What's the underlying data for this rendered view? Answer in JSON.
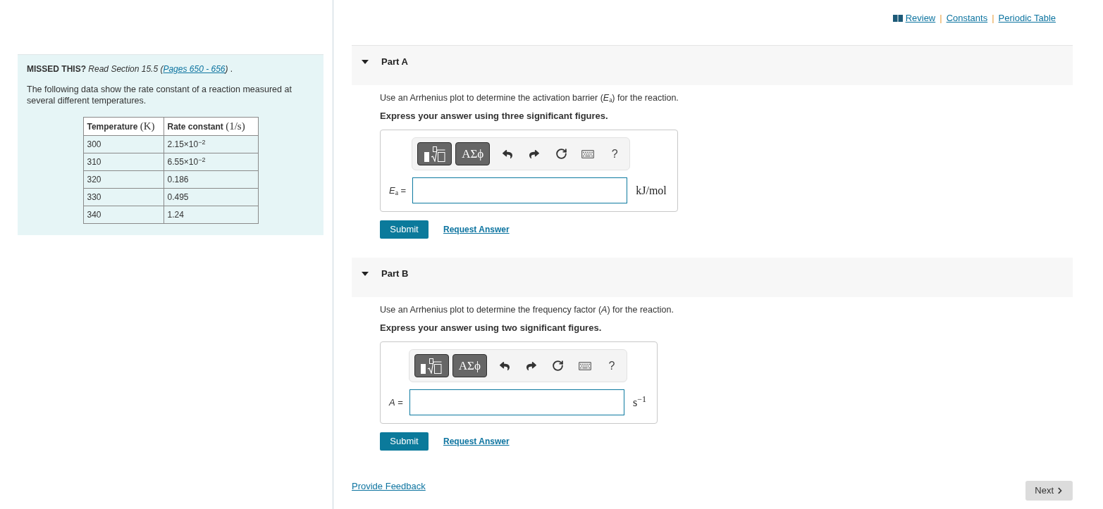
{
  "header": {
    "links": [
      {
        "label": "Review",
        "kind": "book"
      },
      {
        "label": "Constants",
        "kind": "plain",
        "separator": "|"
      },
      {
        "label": "Periodic Table",
        "kind": "plain",
        "separator": "|"
      }
    ]
  },
  "intro": {
    "missed_this": {
      "prefix": "**MISSED THIS?** *Read Section 15.5 (*",
      "link": "Pages 650 - 656",
      "suffix": "*)* ."
    },
    "description": "The following data show the rate constant of a reaction measured at several different temperatures.",
    "table": {
      "columns": [
        {
          "label": "Temperature",
          "unit": "(K)"
        },
        {
          "label": "Rate constant",
          "unit": "(1/s)"
        }
      ],
      "rows": [
        [
          "300",
          "2.15×10$^{−2}$"
        ],
        [
          "310",
          "6.55×10$^{−2}$"
        ],
        [
          "320",
          "0.186"
        ],
        [
          "330",
          "0.495"
        ],
        [
          "340",
          "1.24"
        ]
      ]
    }
  },
  "parts": [
    {
      "title": "Part A",
      "expanded": true,
      "question": "Use an Arrhenius plot to determine the activation barrier (*E*$_{a}$) for the reaction.",
      "instruction": "Express your answer using three significant figures.",
      "toolbar": {
        "symbols_label": "ΑΣϕ",
        "help_label": "?"
      },
      "variable": "*E*$_{a}$ =",
      "unit": "kJ/mol",
      "submit": "Submit",
      "request_answer": "Request Answer"
    },
    {
      "title": "Part B",
      "expanded": true,
      "question": "Use an Arrhenius plot to determine the frequency factor (*A*) for the reaction.",
      "instruction": "Express your answer using two significant figures.",
      "toolbar": {
        "symbols_label": "ΑΣϕ",
        "help_label": "?"
      },
      "variable": "*A* =",
      "unit": "s$^{−1}$",
      "submit": "Submit",
      "request_answer": "Request Answer"
    }
  ],
  "footer": {
    "feedback_link": "Provide Feedback",
    "next_button": "Next"
  }
}
